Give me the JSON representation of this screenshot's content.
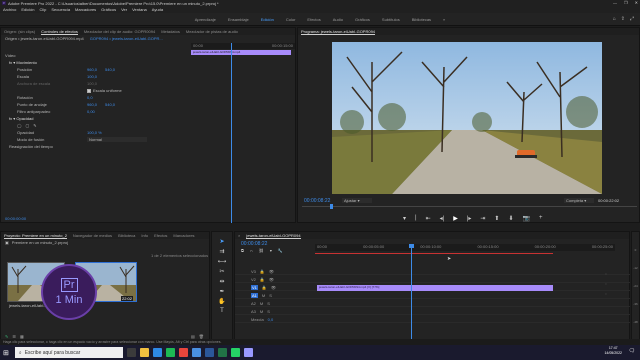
{
  "window": {
    "title": "Adobe Premiere Pro 2022 - C:\\Usuarios\\alber\\Documentos\\Adobe\\Premiere Pro\\15.0\\Premiere en un minuto_2.prproj *",
    "controls": [
      "—",
      "❐",
      "✕"
    ]
  },
  "menu": [
    "Archivo",
    "Edición",
    "Clip",
    "Secuencia",
    "Marcadores",
    "Gráficos",
    "Ver",
    "Ventana",
    "Ayuda"
  ],
  "workspaces": {
    "items": [
      "Aprendizaje",
      "Ensamblaje",
      "Edición",
      "Color",
      "Efectos",
      "Audio",
      "Gráficos",
      "Subtítulos",
      "Bibliotecas"
    ],
    "active_index": 2,
    "overflow": "»"
  },
  "source_panel": {
    "tabs": [
      "Origen: (sin clips)",
      "Controles de efectos",
      "Mezclador del clip de audio: GOPR0094",
      "Metadatos",
      "Mezclador de pistas de audio"
    ],
    "master": "Origen • jewels-taron-eiUabI-GOPR094.mp4",
    "clip_label": "jewels-taron-eiUabI-GOPR094.mp4",
    "sequence_ref": "GOPR094 • jewels-taron-eiUabI-GOPR...",
    "ruler_start": "00:00",
    "ruler_end": "00:00:15:00",
    "video_label": "Vídeo",
    "motion_label": "Movimiento",
    "properties": [
      {
        "name": "Posición",
        "value1": "960,0",
        "value2": "540,0"
      },
      {
        "name": "Escala",
        "value1": "100,0",
        "value2": ""
      },
      {
        "name": "Anchura de escala",
        "value1": "100,0",
        "value2": ""
      },
      {
        "name": "",
        "value1": "Escala uniforme",
        "value2": ""
      },
      {
        "name": "Rotación",
        "value1": "0,0",
        "value2": ""
      },
      {
        "name": "Punto de anclaje",
        "value1": "960,0",
        "value2": "540,0"
      },
      {
        "name": "Filtro antiparpadeo",
        "value1": "0,00",
        "value2": ""
      }
    ],
    "opacity_label": "Opacidad",
    "opacity_value": "100,0 %",
    "blend_label": "Modo de fusión",
    "blend_value": "Normal",
    "remap_label": "Reasignación del tiempo",
    "timecode": "00:00:00:00"
  },
  "program": {
    "tab": "Programa: jewels-taron-eiUabI-GOPR094",
    "timecode": "00:00:08:22",
    "fit": "Ajustar",
    "quality": "Completa",
    "duration": "00:00:22:02"
  },
  "project": {
    "tabs": [
      "Proyecto: Premiere en un minuto_2",
      "Navegador de medios",
      "Biblioteca",
      "Info",
      "Efectos",
      "Marcadores"
    ],
    "file": "Premiere en un minuto_2.prproj",
    "selection": "1 de 2 elementos seleccionados",
    "items": [
      {
        "name": "jewels-taron-eiUabI-GOPR",
        "duration": "22:02"
      },
      {
        "name": "jewels-taron-eiUabI-GOPR094",
        "duration": "22:02"
      }
    ],
    "badge_top": "Pr",
    "badge_bottom": "1 Min"
  },
  "timeline": {
    "tab": "jewels-taron-eiUabI-GOPR094",
    "timecode": "00:00:08:22",
    "ruler": [
      "00:00",
      "00:00:05:00",
      "00:00:10:00",
      "00:00:15:00",
      "00:00:20:00",
      "00:00:25:00"
    ],
    "tracks": [
      "V3",
      "V2",
      "V1",
      "A1",
      "A2",
      "A3"
    ],
    "clip_label": "jewels-taron-eiUabI-GOPR094.mp4 [V] [77%]",
    "mix_label": "Mezcla",
    "mix_value": "0,0",
    "db_labels": [
      "0",
      "-12",
      "-24",
      "-36",
      "-48",
      "dB"
    ]
  },
  "status": "Haga clic para seleccionar, o haga clic en un espacio vacío y arrastre para seleccionar con marco. Use Mayús, Alt y Ctrl para otras opciones.",
  "taskbar": {
    "search_placeholder": "Escribe aquí para buscar",
    "time": "17:47",
    "date": "14/05/2022",
    "icons": [
      {
        "name": "task-view-icon",
        "color": "#3b3b3b"
      },
      {
        "name": "explorer-icon",
        "color": "#f0c040"
      },
      {
        "name": "edge-icon",
        "color": "#2e8ae6"
      },
      {
        "name": "spotify-icon",
        "color": "#1db954"
      },
      {
        "name": "chrome-icon",
        "color": "#e8453c"
      },
      {
        "name": "mail-icon",
        "color": "#4a90e2"
      },
      {
        "name": "word-icon",
        "color": "#2b579a"
      },
      {
        "name": "excel-icon",
        "color": "#217346"
      },
      {
        "name": "whatsapp-icon",
        "color": "#25d366"
      },
      {
        "name": "premiere-icon",
        "color": "#9999ff"
      }
    ]
  },
  "colors": {
    "accent": "#4aa0ff",
    "clip": "#a78bfa",
    "playhead": "#3d8be8",
    "premiere": "#9999ff"
  }
}
